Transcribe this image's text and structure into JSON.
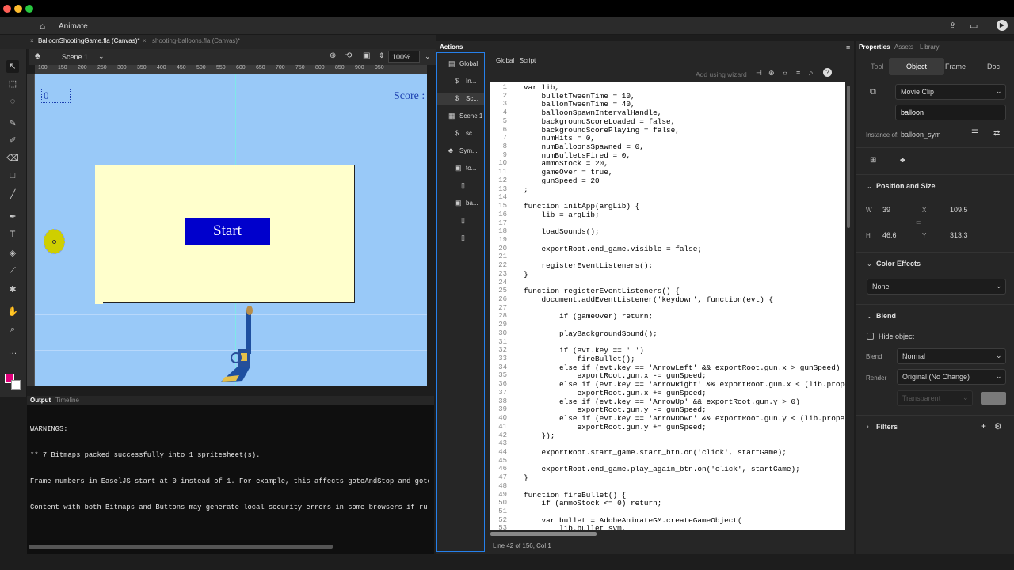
{
  "app": {
    "name": "Animate"
  },
  "tabs": [
    {
      "label": "BalloonShootingGame.fla (Canvas)*"
    },
    {
      "label": "shooting-balloons.fla (Canvas)*"
    }
  ],
  "edit_bar": {
    "scene": "Scene 1",
    "zoom": "100%"
  },
  "ruler": {
    "ticks": [
      "100",
      "150",
      "200",
      "250",
      "300",
      "350",
      "400",
      "450",
      "500",
      "550",
      "600",
      "650",
      "700",
      "750",
      "800",
      "850",
      "900",
      "950"
    ]
  },
  "stage": {
    "score_value": "0",
    "score_label": "Score :",
    "start_button": "Start"
  },
  "output": {
    "tabs": [
      "Output",
      "Timeline"
    ],
    "lines": [
      "WARNINGS:",
      "** 7 Bitmaps packed successfully into 1 spritesheet(s).",
      "Frame numbers in EaselJS start at 0 instead of 1. For example, this affects gotoAndStop and goto",
      "Content with both Bitmaps and Buttons may generate local security errors in some browsers if ru"
    ]
  },
  "actions": {
    "title": "Actions",
    "breadcrumb": "Global : Script",
    "wizard_label": "Add using wizard",
    "status": "Line 42 of 156, Col 1",
    "tree": [
      {
        "label": "Global",
        "indent": 0,
        "icon": "doc-icon"
      },
      {
        "label": "In...",
        "indent": 1,
        "icon": "script-icon"
      },
      {
        "label": "Sc...",
        "indent": 1,
        "icon": "script-icon"
      },
      {
        "label": "Scene 1",
        "indent": 0,
        "icon": "scene-icon"
      },
      {
        "label": "sc...",
        "indent": 1,
        "icon": "script-icon"
      },
      {
        "label": "Sym...",
        "indent": 0,
        "icon": "symbol-icon"
      },
      {
        "label": "to...",
        "indent": 1,
        "icon": "folder-icon"
      },
      {
        "label": "",
        "indent": 2,
        "icon": "frame-icon"
      },
      {
        "label": "ba...",
        "indent": 1,
        "icon": "folder-icon"
      },
      {
        "label": "",
        "indent": 2,
        "icon": "frame-icon"
      },
      {
        "label": "",
        "indent": 2,
        "icon": "frame-icon"
      }
    ],
    "code": [
      "var lib,",
      "    bulletTweenTime = 10,",
      "    ballonTweenTime = 40,",
      "    balloonSpawnIntervalHandle,",
      "    backgroundScoreLoaded = false,",
      "    backgroundScorePlaying = false,",
      "    numHits = 0,",
      "    numBalloonsSpawned = 0,",
      "    numBulletsFired = 0,",
      "    ammoStock = 20,",
      "    gameOver = true,",
      "    gunSpeed = 20",
      ";",
      "",
      "function initApp(argLib) {",
      "    lib = argLib;",
      "",
      "    loadSounds();",
      "",
      "    exportRoot.end_game.visible = false;",
      "",
      "    registerEventListeners();",
      "}",
      "",
      "function registerEventListeners() {",
      "    document.addEventListener('keydown', function(evt) {",
      "",
      "        if (gameOver) return;",
      "",
      "        playBackgroundSound();",
      "",
      "        if (evt.key == ' ')",
      "            fireBullet();",
      "        else if (evt.key == 'ArrowLeft' && exportRoot.gun.x > gunSpeed)",
      "            exportRoot.gun.x -= gunSpeed;",
      "        else if (evt.key == 'ArrowRight' && exportRoot.gun.x < (lib.properties",
      "            exportRoot.gun.x += gunSpeed;",
      "        else if (evt.key == 'ArrowUp' && exportRoot.gun.y > 0)",
      "            exportRoot.gun.y -= gunSpeed;",
      "        else if (evt.key == 'ArrowDown' && exportRoot.gun.y < (lib.properties",
      "            exportRoot.gun.y += gunSpeed;",
      "    });",
      "",
      "    exportRoot.start_game.start_btn.on('click', startGame);",
      "",
      "    exportRoot.end_game.play_again_btn.on('click', startGame);",
      "}",
      "",
      "function fireBullet() {",
      "    if (ammoStock <= 0) return;",
      "",
      "    var bullet = AdobeAnimateGM.createGameObject(",
      "        lib.bullet_sym,"
    ]
  },
  "properties": {
    "tabs": [
      "Properties",
      "Assets",
      "Library"
    ],
    "subtabs": [
      "Tool",
      "Object",
      "Frame",
      "Doc"
    ],
    "symbol_type": "Movie Clip",
    "instance_name": "balloon",
    "instance_of_label": "Instance of:",
    "instance_of": "balloon_sym",
    "position_size": {
      "title": "Position and Size",
      "w_label": "W",
      "w": "39",
      "h_label": "H",
      "h": "46.6",
      "x_label": "X",
      "x": "109.5",
      "y_label": "Y",
      "y": "313.3"
    },
    "color_effects": {
      "title": "Color Effects",
      "value": "None"
    },
    "blend": {
      "title": "Blend",
      "hide_object": "Hide object",
      "blend_label": "Blend",
      "blend_value": "Normal",
      "render_label": "Render",
      "render_value": "Original (No Change)",
      "bg_value": "Transparent"
    },
    "filters": {
      "title": "Filters"
    }
  },
  "colors": {
    "accent": "#2680eb",
    "stage_bg": "#99c9f8",
    "start_btn": "#0000cc"
  }
}
